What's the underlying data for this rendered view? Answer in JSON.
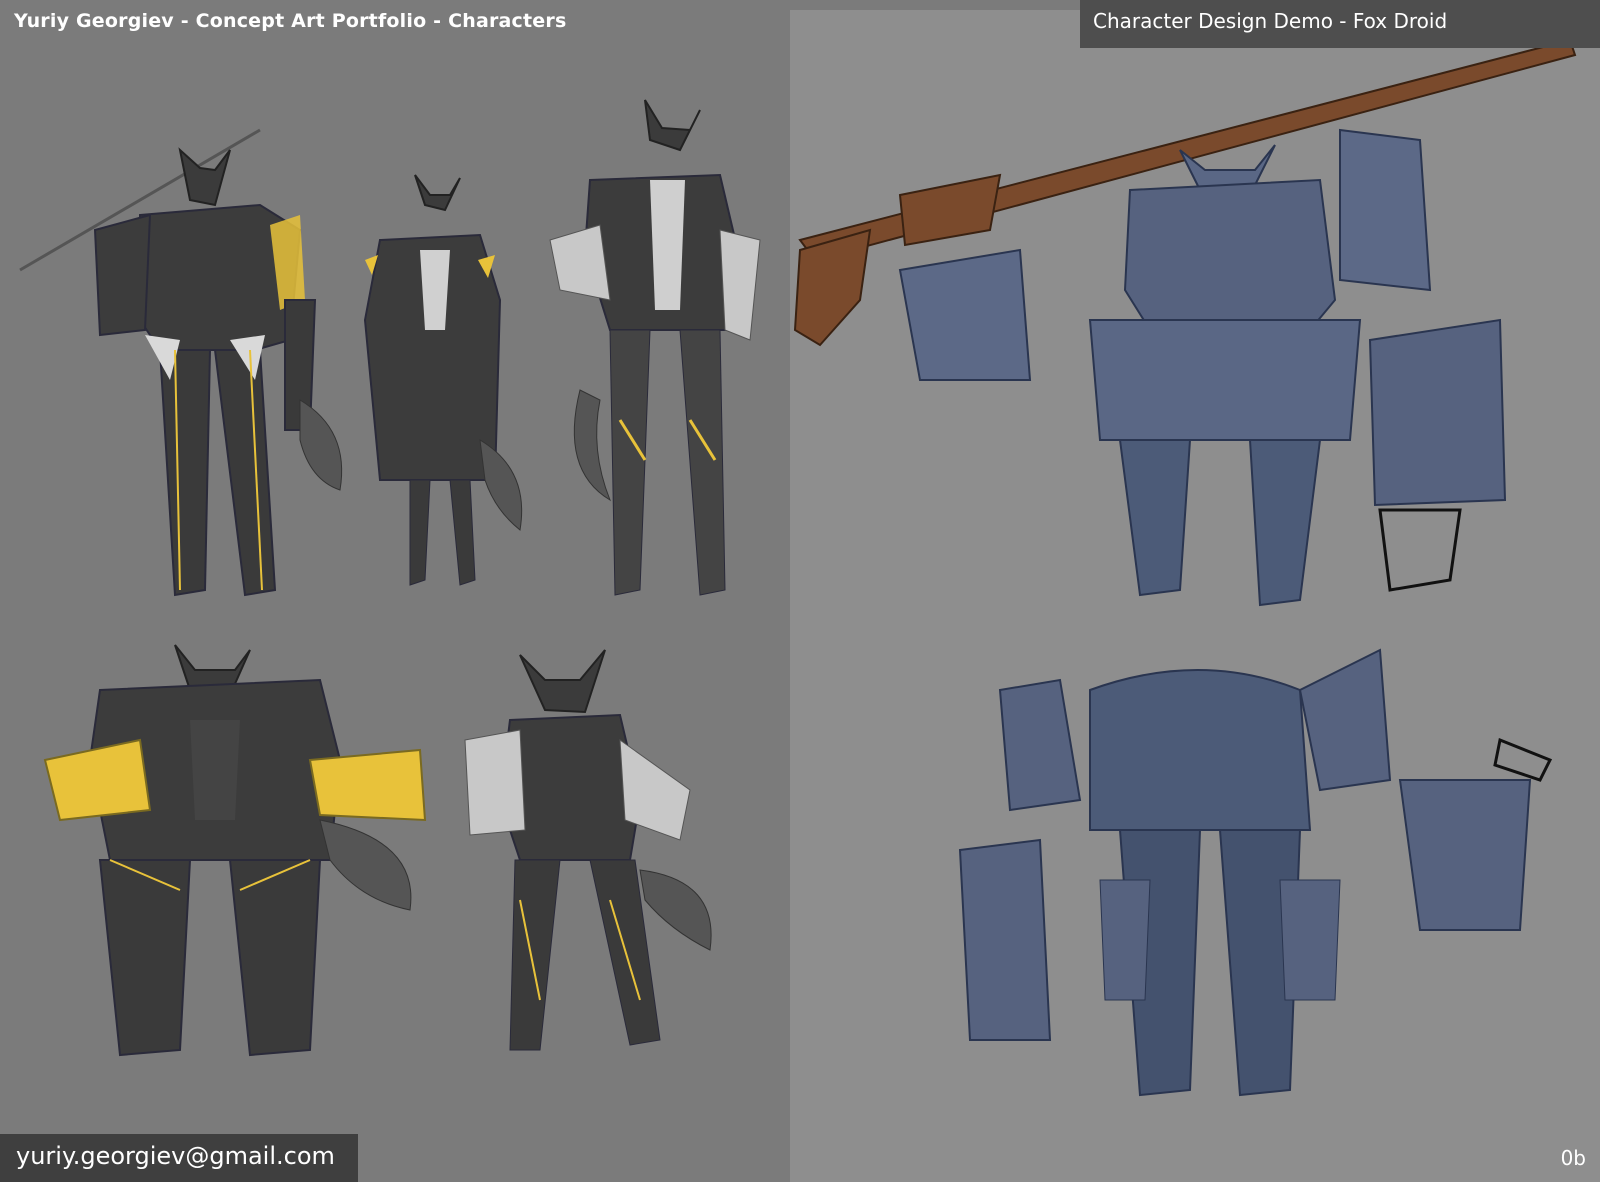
{
  "header": {
    "portfolio_title": "Yuriy Georgiev - Concept Art Portfolio - Characters",
    "demo_title": "Character Design Demo - Fox Droid"
  },
  "footer": {
    "email": "yuriy.georgiev@gmail.com",
    "page_number": "0b"
  },
  "colors": {
    "left_background": "#7b7b7b",
    "right_background": "#8e8e8e",
    "suit_dark": "#3c3c3c",
    "gold_trim": "#e8c23a",
    "droid_blue": "#4c5b78",
    "rifle_brown": "#7a4a2c"
  }
}
